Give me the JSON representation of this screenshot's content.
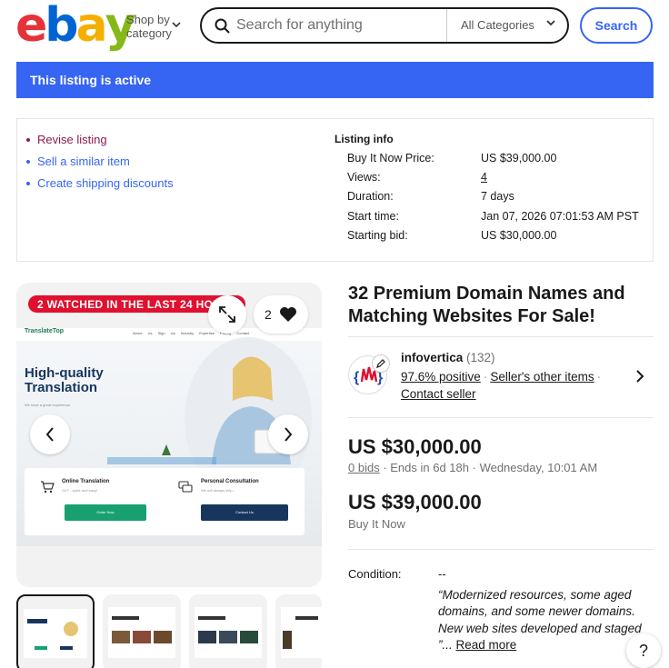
{
  "header": {
    "logo_letters": [
      "e",
      "b",
      "a",
      "y"
    ],
    "logo_colors": [
      "#e53238",
      "#0064d2",
      "#f5af02",
      "#86b817"
    ],
    "shop_by_line1": "Shop by",
    "shop_by_line2": "category",
    "search_placeholder": "Search for anything",
    "category_select": "All Categories",
    "search_button": "Search"
  },
  "banner": {
    "text": "This listing is active",
    "color": "#3665f3"
  },
  "actions": [
    "Revise listing",
    "Sell a similar item",
    "Create shipping discounts"
  ],
  "listing_info": {
    "title": "Listing info",
    "rows": [
      {
        "label": "Buy It Now Price:",
        "value": "US $39,000.00"
      },
      {
        "label": "Views:",
        "value": "4"
      },
      {
        "label": "Duration:",
        "value": "7 days"
      },
      {
        "label": "Start time:",
        "value": "Jan 07, 2026 07:01:53 AM PST"
      },
      {
        "label": "Starting bid:",
        "value": "US $30,000.00"
      }
    ]
  },
  "gallery": {
    "watched_badge": "2 WATCHED IN THE LAST 24 HOURS",
    "watch_count": "2",
    "image": {
      "site_logo": "TranslateTop",
      "nav": "About Us  Sign Up  Industry Expertise  Pricing  Contact",
      "headline_line1": "High-quality",
      "headline_line2": "Translation",
      "subtext": "We have a great experience.",
      "card1_title": "Online Translation",
      "card1_sub": "24/7 - quick and easy!",
      "card1_button": "Order Now",
      "card2_title": "Personal Consultation",
      "card2_sub": "We will always help...",
      "card2_button": "Contact Us"
    },
    "thumbnail_count": 4
  },
  "item": {
    "title": "32 Premium Domain Names and Matching Websites For Sale!",
    "seller": {
      "name": "infovertica",
      "count": "(132)",
      "feedback": "97.6% positive",
      "other_items": "Seller's other items",
      "contact": "Contact seller"
    },
    "bid_price": "US $30,000.00",
    "bids": "0 bids",
    "ends": "Ends in 6d 18h",
    "end_time": "Wednesday, 10:01 AM",
    "bin_price": "US $39,000.00",
    "bin_label": "Buy It Now",
    "condition_label": "Condition:",
    "condition_value": "--",
    "description": "“Modernized resources, some aged domains, and some newer domains. New web sites developed and staged ”...",
    "read_more": "Read more"
  },
  "help": "?"
}
